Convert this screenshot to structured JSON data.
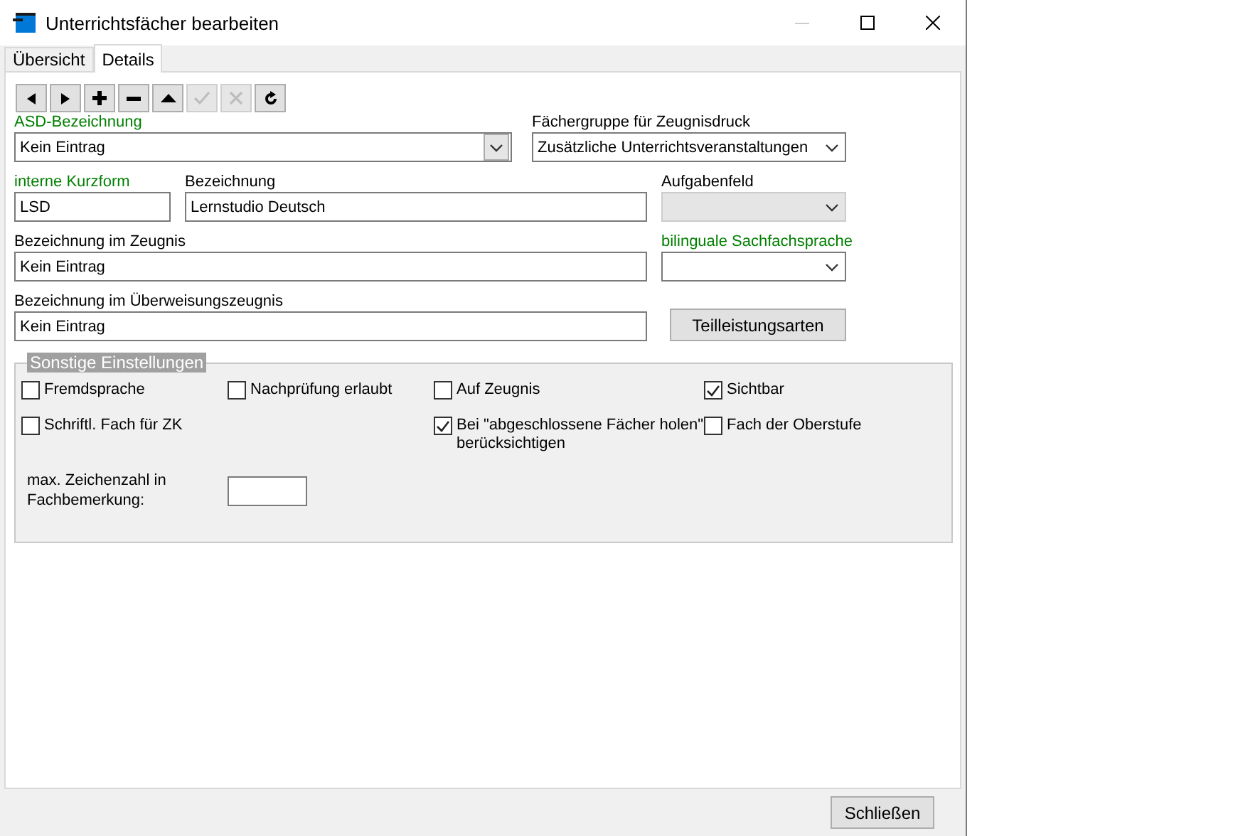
{
  "window": {
    "title": "Unterrichtsfächer bearbeiten",
    "minimize_disabled": true
  },
  "tabs": [
    {
      "label": "Übersicht",
      "selected": false
    },
    {
      "label": "Details",
      "selected": true
    }
  ],
  "toolbar": [
    {
      "kind": "previous",
      "disabled": false
    },
    {
      "kind": "next",
      "disabled": false
    },
    {
      "kind": "add",
      "disabled": false
    },
    {
      "kind": "remove",
      "disabled": false
    },
    {
      "kind": "up",
      "disabled": false
    },
    {
      "kind": "confirm",
      "disabled": true
    },
    {
      "kind": "cancel",
      "disabled": true
    },
    {
      "kind": "refresh",
      "disabled": false
    }
  ],
  "form_rows": [
    [
      {
        "kind": "select",
        "label": "ASD-Bezeichnung",
        "highlighted": true,
        "value": "Kein Eintrag",
        "disabled": false
      },
      {
        "kind": "select",
        "label": "Fächergruppe für Zeugnisdruck",
        "highlighted": false,
        "value": "Zusätzliche Unterrichtsveranstaltungen",
        "disabled": false
      }
    ],
    [
      {
        "kind": "text",
        "label": "interne Kurzform",
        "highlighted": true,
        "value": "LSD"
      },
      {
        "kind": "text",
        "label": "Bezeichnung",
        "highlighted": false,
        "value": "Lernstudio Deutsch"
      },
      {
        "kind": "select",
        "label": "Aufgabenfeld",
        "highlighted": false,
        "disabled": true
      }
    ],
    [
      {
        "kind": "text",
        "label": "Bezeichnung im Zeugnis",
        "highlighted": false,
        "value": "Kein Eintrag"
      },
      {
        "kind": "select",
        "label": "bilinguale Sachfachsprache",
        "highlighted": true,
        "disabled": false
      }
    ],
    [
      {
        "kind": "text",
        "label": "Bezeichnung im Überweisungszeugnis",
        "highlighted": false,
        "value": "Kein Eintrag"
      },
      {
        "kind": "button",
        "label": "Teilleistungsarten"
      }
    ]
  ],
  "settings": {
    "title": "Sonstige Einstellungen",
    "checkboxes": [
      {
        "label": "Fremdsprache",
        "checked": false
      },
      {
        "label": "Nachprüfung erlaubt",
        "checked": false
      },
      {
        "label": "Auf Zeugnis",
        "checked": false
      },
      {
        "label": "Sichtbar",
        "checked": true
      },
      {
        "label": "Schriftl. Fach für ZK",
        "checked": false
      },
      {
        "label": "Bei \"abgeschlossene Fächer holen\" berücksichtigen",
        "checked": true
      },
      {
        "label": "Fach der Oberstufe",
        "checked": false
      }
    ],
    "max_chars": {
      "label": "max. Zeichenzahl in Fachbemerkung:"
    }
  },
  "footer": {
    "close_button": "Schließen"
  }
}
